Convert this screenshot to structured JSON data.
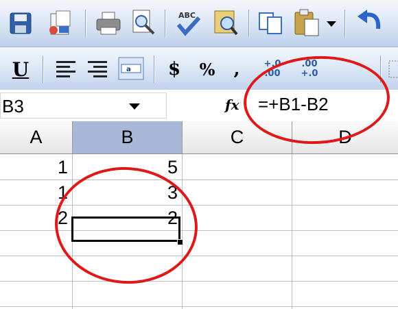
{
  "toolbar_standard": {
    "icons": [
      "save-icon",
      "permission-icon",
      "print-icon",
      "print-preview-icon",
      "spelling-icon",
      "research-icon",
      "copy-icon",
      "paste-icon",
      "paste-options-dropdown",
      "undo-icon"
    ]
  },
  "toolbar_formatting": {
    "underline_label": "U",
    "currency_label": "$",
    "percent_label": "%",
    "comma_label": ",",
    "increase_decimal_top": "+.0",
    "increase_decimal_bottom": ".00",
    "decrease_decimal_top": ".00",
    "decrease_decimal_bottom": "+.0"
  },
  "formula_bar": {
    "name_box": "B3",
    "fx_label": "fx",
    "formula": "=+B1-B2"
  },
  "sheet": {
    "columns": [
      "A",
      "B",
      "C",
      "D"
    ],
    "selected_column": "B",
    "rows": [
      {
        "A": "1",
        "B": "5",
        "C": "",
        "D": ""
      },
      {
        "A": "1",
        "B": "3",
        "C": "",
        "D": ""
      },
      {
        "A": "2",
        "B": "2",
        "C": "",
        "D": ""
      }
    ],
    "active_cell": "B3"
  },
  "annotations": {
    "color": "#e01818",
    "items": [
      "formula-highlight-circle",
      "values-highlight-circle"
    ]
  },
  "colors": {
    "toolbar_top": "#f5f8fd",
    "toolbar_bottom": "#bfd0ea",
    "selected_header": "#a9b8d8"
  }
}
